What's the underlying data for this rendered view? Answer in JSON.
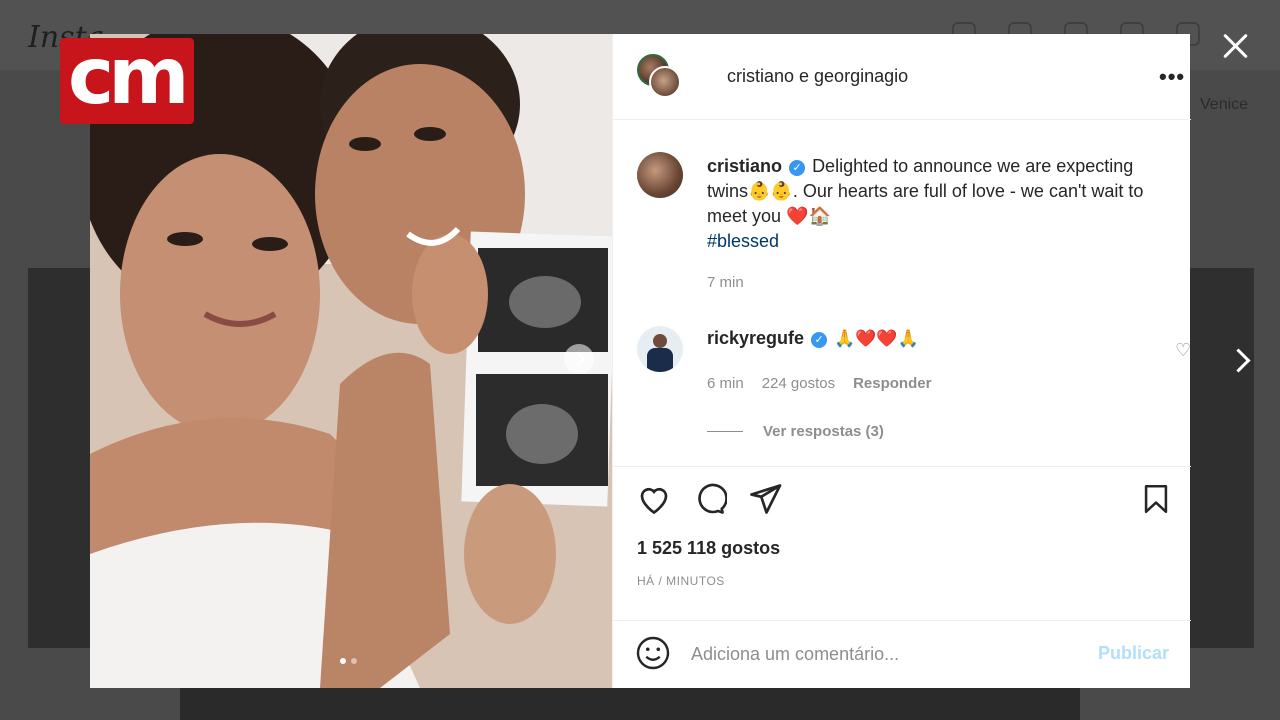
{
  "background": {
    "logo_text": "Insta",
    "side_text": "Venice"
  },
  "overlay_logo": "cm",
  "header": {
    "title": "cristiano e georginagio",
    "more": "•••"
  },
  "caption": {
    "user": "cristiano",
    "verified": "✓",
    "text": "Delighted to announce we are expecting twins👶👶. Our hearts are full of love - we can't wait to meet you ❤️🏠",
    "hashtag": "#blessed",
    "time": "7 min"
  },
  "comment": {
    "user": "rickyregufe",
    "verified": "✓",
    "text": "🙏❤️❤️🙏",
    "time": "6 min",
    "likes": "224 gostos",
    "reply": "Responder",
    "view_replies": "Ver respostas (3)"
  },
  "likes": "1 525 118 gostos",
  "posted": "HÁ / MINUTOS",
  "add_comment": {
    "placeholder": "Adiciona um comentário...",
    "publish": "Publicar"
  },
  "colors": {
    "accent": "#3897f0",
    "hashtag": "#00376b",
    "publish_disabled": "#b2dffc",
    "cm_red": "#c8151b"
  },
  "icons": [
    "close-icon",
    "next-arrow-icon",
    "more-icon",
    "heart-icon",
    "comment-icon",
    "share-icon",
    "bookmark-icon",
    "smiley-icon"
  ]
}
